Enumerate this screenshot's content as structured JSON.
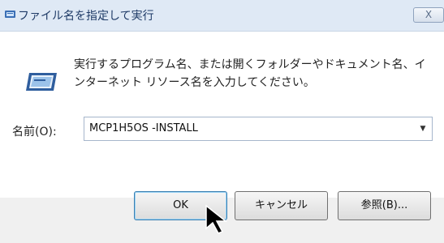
{
  "window": {
    "title": "ファイル名を指定して実行",
    "close_label": "X"
  },
  "description": "実行するプログラム名、または開くフォルダーやドキュメント名、インターネット リソース名を入力してください。",
  "name_field": {
    "label": "名前(O):",
    "value": "MCP1H5OS -INSTALL"
  },
  "buttons": {
    "ok": "OK",
    "cancel": "キャンセル",
    "browse": "参照(B)..."
  },
  "icons": {
    "title": "run-icon",
    "main": "run-icon",
    "close": "close-icon",
    "dropdown": "chevron-down-icon",
    "cursor": "mouse-pointer-icon"
  },
  "colors": {
    "titlebar": "#dfe9f5",
    "title_text": "#1e3a66",
    "footer": "#f0f0f0",
    "ok_border": "#3c7fb1"
  }
}
